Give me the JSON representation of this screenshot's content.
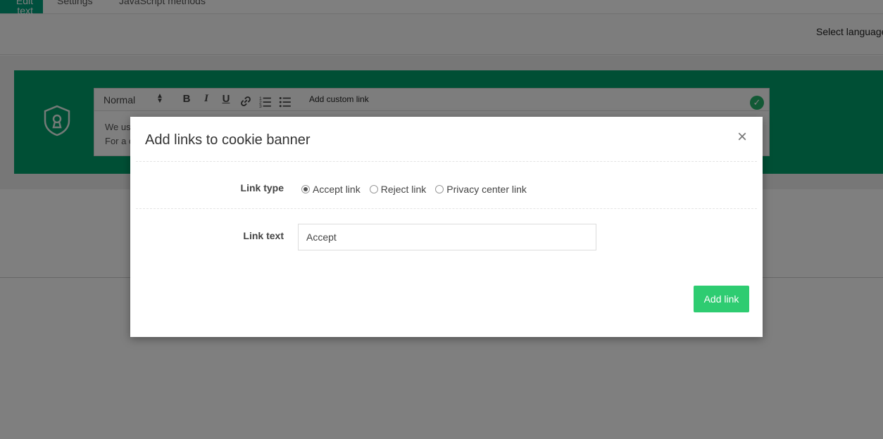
{
  "tabs": [
    {
      "label": "Edit text",
      "active": true
    },
    {
      "label": "Settings",
      "active": false
    },
    {
      "label": "JavaScript methods",
      "active": false
    }
  ],
  "language_bar": {
    "label": "Select language"
  },
  "editor": {
    "format_select": "Normal",
    "toolbar_buttons": [
      "bold-icon",
      "italic-icon",
      "underline-icon",
      "link-icon",
      "ordered-list-icon",
      "bullet-list-icon"
    ],
    "add_custom_link": "Add custom link",
    "body_line1": "We us",
    "body_line2": "For a c"
  },
  "modal": {
    "title": "Add links to cookie banner",
    "close_symbol": "×",
    "link_type_label": "Link type",
    "link_types": [
      {
        "label": "Accept link",
        "checked": true
      },
      {
        "label": "Reject link",
        "checked": false
      },
      {
        "label": "Privacy center link",
        "checked": false
      }
    ],
    "link_text_label": "Link text",
    "link_text_value": "Accept",
    "submit_label": "Add link"
  },
  "colors": {
    "banner": "#009e6a",
    "accent": "#009e7a",
    "submit": "#2ecc71"
  }
}
